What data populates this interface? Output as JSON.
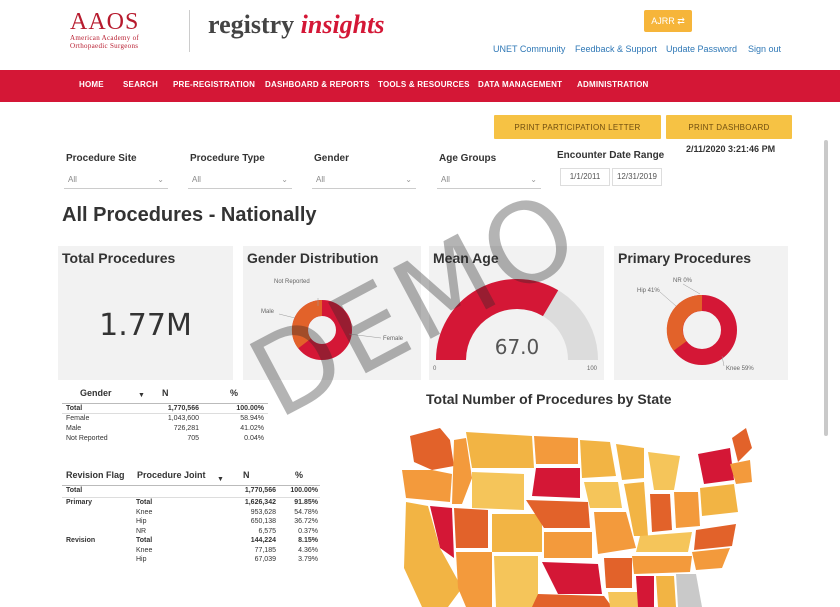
{
  "header": {
    "logo_main": "AAOS",
    "logo_sub_1": "American Academy of",
    "logo_sub_2": "Orthopaedic Surgeons",
    "app_name_1": "registry",
    "app_name_2": "insights",
    "ajrr_button": "AJRR ⇄",
    "links": [
      "UNET Community",
      "Feedback & Support",
      "Update Password",
      "Sign out"
    ]
  },
  "nav": {
    "items": [
      "HOME",
      "SEARCH",
      "PRE-REGISTRATION",
      "DASHBOARD & REPORTS",
      "TOOLS & RESOURCES",
      "DATA MANAGEMENT",
      "ADMINISTRATION"
    ]
  },
  "actions": {
    "print_letter": "PRINT PARTICIPATION LETTER",
    "print_dashboard": "PRINT DASHBOARD",
    "timestamp": "2/11/2020 3:21:46 PM"
  },
  "filters": {
    "items": [
      {
        "label": "Procedure Site",
        "value": "All"
      },
      {
        "label": "Procedure Type",
        "value": "All"
      },
      {
        "label": "Gender",
        "value": "All"
      },
      {
        "label": "Age Groups",
        "value": "All"
      }
    ],
    "encounter_label": "Encounter Date Range",
    "date_from": "1/1/2011",
    "date_to": "12/31/2019"
  },
  "page_title": "All Procedures - Nationally",
  "cards": {
    "total": {
      "title": "Total Procedures",
      "value": "1.77M"
    },
    "gender": {
      "title": "Gender Distribution",
      "labels": [
        "Not Reported",
        "Male",
        "Female"
      ],
      "shares": [
        0.0004,
        0.4102,
        0.5894
      ]
    },
    "age": {
      "title": "Mean Age",
      "value": "67.0",
      "min": "0",
      "max": "100",
      "fraction": 0.67
    },
    "primary": {
      "title": "Primary Procedures",
      "labels": [
        "NR 0%",
        "Hip 41%",
        "Knee 59%"
      ],
      "shares": [
        0.004,
        0.41,
        0.586
      ]
    }
  },
  "gender_table": {
    "headers": [
      "Gender",
      "N",
      "%"
    ],
    "rows": [
      [
        "Total",
        "1,770,566",
        "100.00%"
      ],
      [
        "Female",
        "1,043,600",
        "58.94%"
      ],
      [
        "Male",
        "726,281",
        "41.02%"
      ],
      [
        "Not Reported",
        "705",
        "0.04%"
      ]
    ]
  },
  "revision_table": {
    "headers": [
      "Revision Flag",
      "Procedure Joint",
      "N",
      "%"
    ],
    "rows": [
      [
        "Total",
        "",
        "1,770,566",
        "100.00%"
      ],
      [
        "Primary",
        "Total",
        "1,626,342",
        "91.85%"
      ],
      [
        "",
        "Knee",
        "953,628",
        "54.78%"
      ],
      [
        "",
        "Hip",
        "650,138",
        "36.72%"
      ],
      [
        "",
        "NR",
        "6,575",
        "0.37%"
      ],
      [
        "Revision",
        "Total",
        "144,224",
        "8.15%"
      ],
      [
        "",
        "Knee",
        "77,185",
        "4.36%"
      ],
      [
        "",
        "Hip",
        "67,039",
        "3.79%"
      ]
    ]
  },
  "map": {
    "title": "Total Number of Procedures by State"
  },
  "watermark": "DEMO",
  "colors": {
    "brand_red": "#d41736",
    "accent_yellow": "#f6c244",
    "orange": "#e2622a"
  }
}
